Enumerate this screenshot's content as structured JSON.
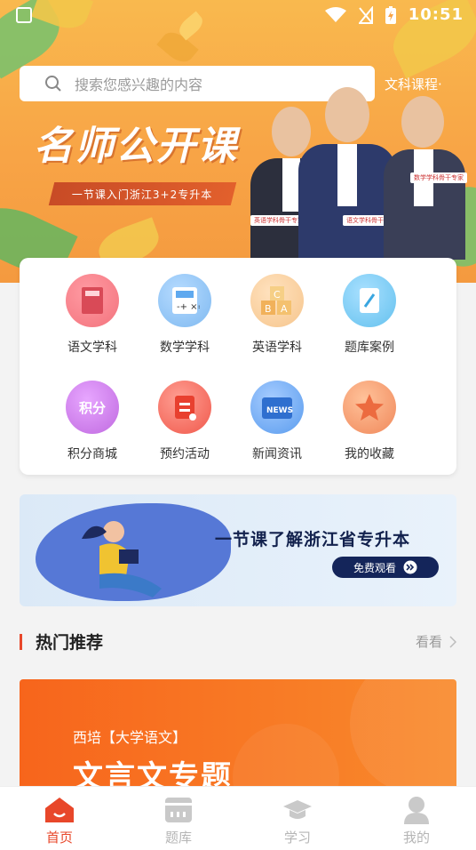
{
  "status_bar": {
    "time": "10:51"
  },
  "search": {
    "placeholder": "搜索您感兴趣的内容",
    "category": "文科课程·"
  },
  "hero": {
    "title": "名师公开课",
    "strip": "一节课入门浙江3+2专升本",
    "teacher_tags": [
      "英语学科骨干专家",
      "语文学科骨干专家",
      "数学学科骨干专家"
    ]
  },
  "menu": {
    "items": [
      {
        "label": "语文学科",
        "icon": "chinese-book-icon",
        "color": "#f3737d"
      },
      {
        "label": "数学学科",
        "icon": "calculator-icon",
        "color": "#5fa9ef"
      },
      {
        "label": "英语学科",
        "icon": "abc-blocks-icon",
        "color": "#f2b574"
      },
      {
        "label": "题库案例",
        "icon": "question-pad-icon",
        "color": "#52b8ec"
      },
      {
        "label": "积分商城",
        "icon": "points-icon",
        "color": "#b25ad6"
      },
      {
        "label": "预约活动",
        "icon": "reservation-icon",
        "color": "#f25b4d"
      },
      {
        "label": "新闻资讯",
        "icon": "news-tv-icon",
        "color": "#3b87e6"
      },
      {
        "label": "我的收藏",
        "icon": "star-icon",
        "color": "#f08a54"
      }
    ],
    "points_text": "积分",
    "news_text": "NEWS"
  },
  "promo": {
    "title": "一节课了解浙江省专升本",
    "button": "免费观看"
  },
  "hot": {
    "title": "热门推荐",
    "more": "看看"
  },
  "course": {
    "subtitle": "西培【大学语文】",
    "title": "文言文专题"
  },
  "bottom_nav": {
    "items": [
      {
        "label": "首页",
        "active": true
      },
      {
        "label": "题库",
        "active": false
      },
      {
        "label": "学习",
        "active": false
      },
      {
        "label": "我的",
        "active": false
      }
    ]
  },
  "colors": {
    "accent": "#e8472a",
    "hero": "#f8a446",
    "promo_navy": "#14255a"
  }
}
